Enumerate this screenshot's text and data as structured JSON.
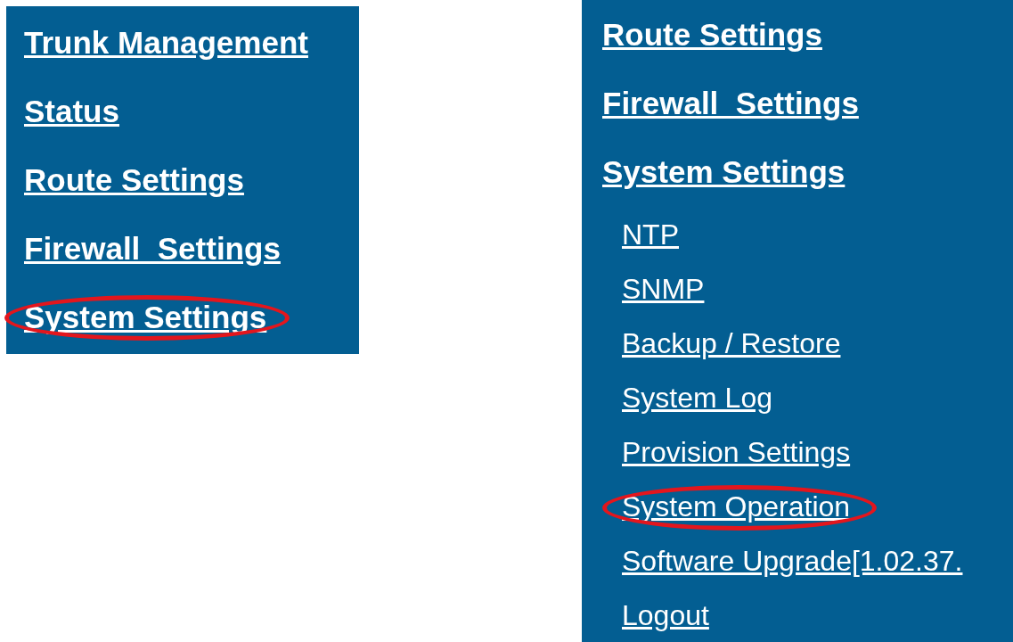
{
  "left_panel": {
    "items": [
      {
        "label": "Trunk Management",
        "highlighted": false
      },
      {
        "label": "Status",
        "highlighted": false
      },
      {
        "label": "Route Settings",
        "highlighted": false
      },
      {
        "label": "Firewall  Settings",
        "highlighted": false
      },
      {
        "label": "System Settings",
        "highlighted": true
      }
    ]
  },
  "right_panel": {
    "items": [
      {
        "label": "Route Settings",
        "kind": "section",
        "highlighted": false
      },
      {
        "label": "Firewall  Settings",
        "kind": "section",
        "highlighted": false
      },
      {
        "label": "System Settings",
        "kind": "section",
        "highlighted": false
      },
      {
        "label": "NTP",
        "kind": "sub",
        "highlighted": false
      },
      {
        "label": "SNMP",
        "kind": "sub",
        "highlighted": false
      },
      {
        "label": "Backup / Restore",
        "kind": "sub",
        "highlighted": false
      },
      {
        "label": "System Log",
        "kind": "sub",
        "highlighted": false
      },
      {
        "label": "Provision Settings",
        "kind": "sub",
        "highlighted": false
      },
      {
        "label": "System Operation",
        "kind": "sub",
        "highlighted": true
      },
      {
        "label": "Software Upgrade[1.02.37.",
        "kind": "sub",
        "highlighted": false
      },
      {
        "label": "Logout",
        "kind": "sub",
        "highlighted": false
      }
    ]
  }
}
